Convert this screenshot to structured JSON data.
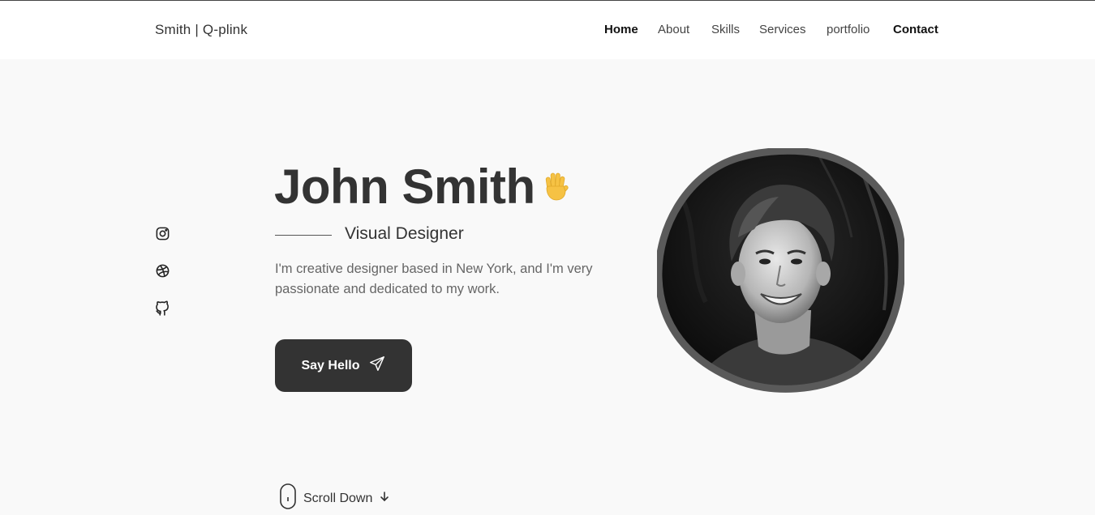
{
  "header": {
    "logo": "Smith | Q-plink",
    "nav": [
      {
        "label": "Home",
        "active": true
      },
      {
        "label": "About"
      },
      {
        "label": "Skills"
      },
      {
        "label": "Services"
      },
      {
        "label": "portfolio"
      },
      {
        "label": "Contact"
      }
    ]
  },
  "social": [
    {
      "name": "instagram-icon"
    },
    {
      "name": "dribbble-icon"
    },
    {
      "name": "github-icon"
    }
  ],
  "hero": {
    "name": "John Smith",
    "wave_icon": "waving-hand-icon",
    "subtitle": "Visual Designer",
    "description": "I'm creative designer based in New York, and I'm very passionate and dedicated to my work.",
    "cta_label": "Say Hello",
    "cta_icon": "send-icon"
  },
  "scroll": {
    "label": "Scroll Down",
    "icon": "mouse-icon",
    "arrow_icon": "arrow-down-icon"
  },
  "colors": {
    "background": "#f9f9f9",
    "header": "#ffffff",
    "text": "#333333",
    "button": "#333333",
    "wave": "#f6c244"
  }
}
